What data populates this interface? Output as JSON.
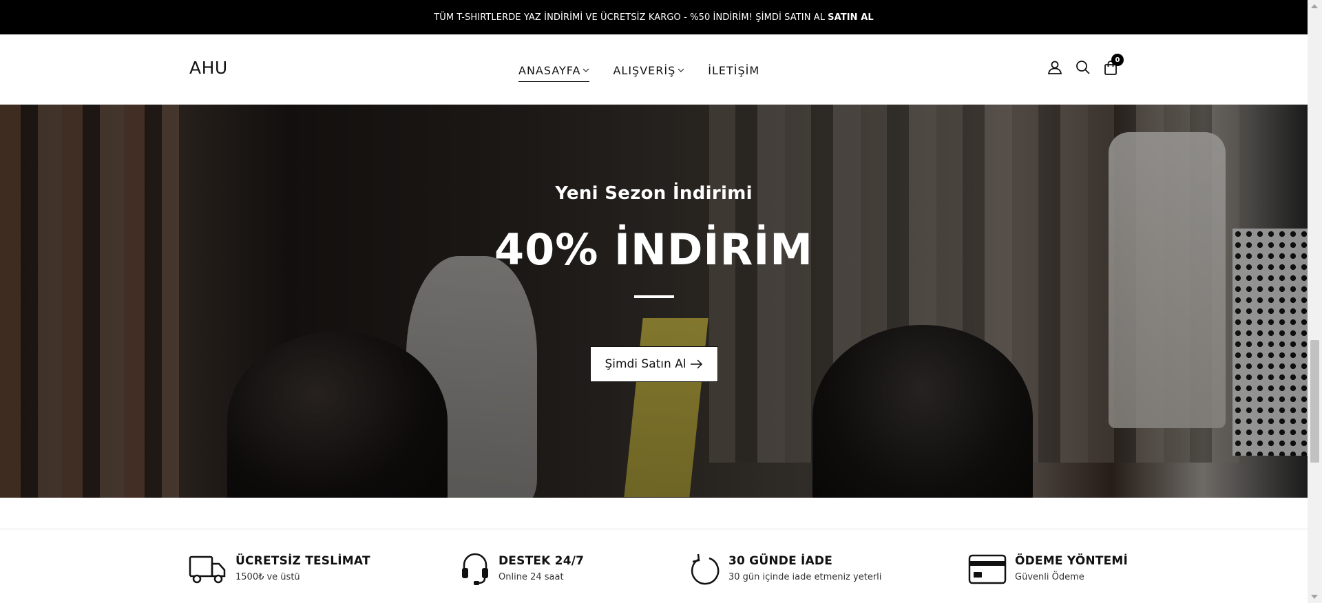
{
  "announcement": {
    "text": "TÜM T-SHIRTLERDE YAZ İNDİRİMİ VE ÜCRETSİZ KARGO - %50 İNDİRİM! ŞİMDİ SATIN AL",
    "link": "SATIN AL"
  },
  "header": {
    "logo": "AHU",
    "nav": [
      {
        "label": "ANASAYFA",
        "active": true,
        "has_dropdown": true
      },
      {
        "label": "ALIŞVERİŞ",
        "active": false,
        "has_dropdown": true
      },
      {
        "label": "İLETİŞİM",
        "active": false,
        "has_dropdown": false
      }
    ],
    "icons": [
      "user-icon",
      "search-icon",
      "cart-icon"
    ],
    "cart_count": "0"
  },
  "hero": {
    "subtitle": "Yeni Sezon İndirimi",
    "title": "40% İNDİRİM",
    "button_label": "Şimdi Satın Al"
  },
  "features": [
    {
      "icon": "truck-icon",
      "title": "ÜCRETSİZ TESLİMAT",
      "subtitle": "1500₺ ve üstü"
    },
    {
      "icon": "headset-icon",
      "title": "DESTEK 24/7",
      "subtitle": "Online 24 saat"
    },
    {
      "icon": "refresh-icon",
      "title": "30 GÜNDE İADE",
      "subtitle": "30 gün içinde iade etmeniz yeterli"
    },
    {
      "icon": "credit-card-icon",
      "title": "ÖDEME YÖNTEMİ",
      "subtitle": "Güvenli Ödeme"
    }
  ],
  "colors": {
    "bar": "#000000",
    "accent": "#111111",
    "background": "#ffffff"
  }
}
